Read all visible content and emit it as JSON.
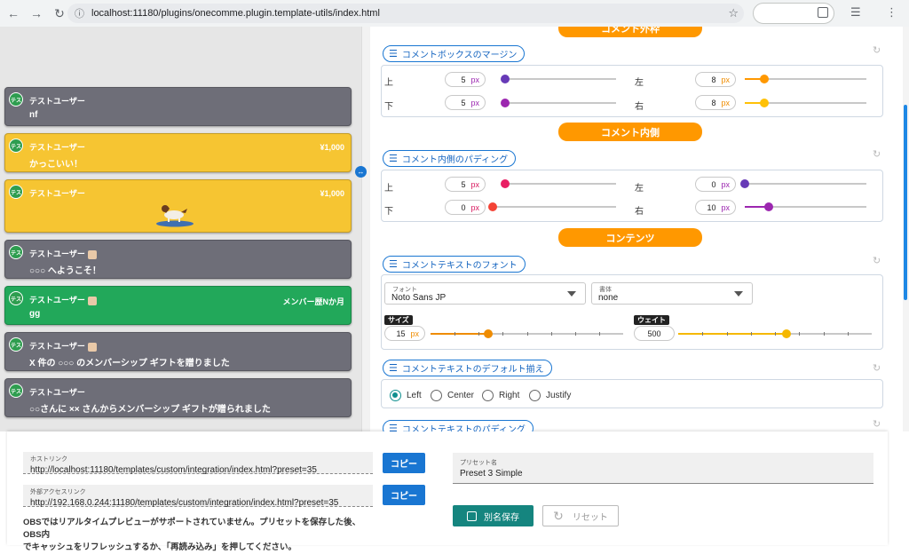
{
  "browser": {
    "url": "localhost:11180/plugins/onecomme.plugin.template-utils/index.html"
  },
  "comments": [
    {
      "name": "テストユーザー",
      "avatar": "テス",
      "message": "nf",
      "amount": "",
      "style": "gray",
      "badge": false
    },
    {
      "name": "テストユーザー",
      "avatar": "テス",
      "message": "かっこいい！",
      "amount": "¥1,000",
      "style": "yellow",
      "badge": false
    },
    {
      "name": "テストユーザー",
      "avatar": "テス",
      "message": "",
      "amount": "¥1,000",
      "style": "yellow",
      "badge": false,
      "sticker": true
    },
    {
      "name": "テストユーザー",
      "avatar": "テス",
      "message": "○○○ へようこそ！",
      "amount": "",
      "style": "gray",
      "badge": true
    },
    {
      "name": "テストユーザー",
      "avatar": "テス",
      "message": "gg",
      "amount": "メンバー歴Nか月",
      "style": "green",
      "badge": true
    },
    {
      "name": "テストユーザー",
      "avatar": "テス",
      "message": "X 件の ○○○ のメンバーシップ ギフトを贈りました",
      "amount": "",
      "style": "gray",
      "badge": true
    },
    {
      "name": "テストユーザー",
      "avatar": "テス",
      "message": "○○さんに ×× さんからメンバーシップ ギフトが贈られました",
      "amount": "",
      "style": "gray",
      "badge": false
    }
  ],
  "settings": {
    "header_outer": "コメント外枠",
    "margin": {
      "title": "コメントボックスのマージン",
      "top": {
        "label": "上",
        "value": "5",
        "unit": "px",
        "level": 0.03
      },
      "bottom": {
        "label": "下",
        "value": "5",
        "unit": "px",
        "level": 0.03
      },
      "left": {
        "label": "左",
        "value": "8",
        "unit": "px",
        "level": 0.16
      },
      "right": {
        "label": "右",
        "value": "8",
        "unit": "px",
        "level": 0.16
      }
    },
    "header_inner": "コメント内側",
    "padding": {
      "title": "コメント内側のパディング",
      "top": {
        "label": "上",
        "value": "5",
        "unit": "px",
        "level": 0.03
      },
      "bottom": {
        "label": "下",
        "value": "0",
        "unit": "px",
        "level": 0.0
      },
      "left": {
        "label": "左",
        "value": "0",
        "unit": "px",
        "level": 0.0
      },
      "right": {
        "label": "右",
        "value": "10",
        "unit": "px",
        "level": 0.2
      }
    },
    "header_contents": "コンテンツ",
    "font": {
      "title": "コメントテキストのフォント",
      "family_label": "フォント",
      "family_value": "Noto Sans JP",
      "style_label": "書体",
      "style_value": "none",
      "size_label": "サイズ",
      "size_value": "15",
      "size_unit": "px",
      "size_level": 0.3,
      "weight_label": "ウェイト",
      "weight_value": "500",
      "weight_level": 0.56
    },
    "align": {
      "title": "コメントテキストのデフォルト揃え",
      "options": [
        "Left",
        "Center",
        "Right",
        "Justify"
      ],
      "selected": "Left"
    },
    "text_padding_title": "コメントテキストのパディング"
  },
  "bottom": {
    "host_link_label": "ホストリンク",
    "host_link": "http://localhost:11180/templates/custom/integration/index.html?preset=35",
    "external_link_label": "外部アクセスリンク",
    "external_link": "http://192.168.0.244:11180/templates/custom/integration/index.html?preset=35",
    "copy_label": "コピー",
    "preset_label": "プリセット名",
    "preset_value": "Preset 3 Simple",
    "save_as_label": "別名保存",
    "reset_label": "リセット",
    "note_line1": "OBSではリアルタイムプレビューがサポートされていません。プリセットを保存した後、OBS内",
    "note_line2": "でキャッシュをリフレッシュするか、「再読み込み」を押してください。"
  },
  "colors": {
    "accent_orange": "#ff9800",
    "accent_blue": "#1976d2",
    "teal": "#15857f",
    "comment_gray": "#6e6e78",
    "comment_yellow": "#f6c532",
    "comment_green": "#22a85a"
  }
}
